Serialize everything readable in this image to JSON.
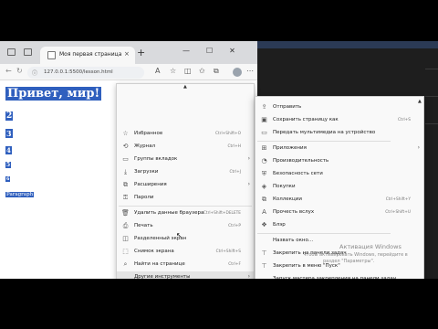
{
  "browser": {
    "tab_title": "Моя первая страница",
    "close_glyph": "×",
    "new_tab_glyph": "+",
    "url": "127.0.0.1:5500/lesson.html",
    "window_buttons": [
      "—",
      "☐",
      "✕"
    ]
  },
  "page": {
    "heading": "Привет, мир!",
    "items": [
      "2",
      "3",
      "4",
      "5",
      "6"
    ],
    "paragraph": "Paragraph"
  },
  "menu": {
    "items": [
      {
        "label": "Избранное",
        "shortcut": "Ctrl+Shift+O",
        "icon": "star-list-icon"
      },
      {
        "label": "Журнал",
        "shortcut": "Ctrl+H",
        "icon": "history-icon"
      },
      {
        "label": "Группы вкладок",
        "shortcut": "",
        "icon": "tab-groups-icon",
        "arrow": true
      },
      {
        "label": "Загрузки",
        "shortcut": "Ctrl+J",
        "icon": "download-icon"
      },
      {
        "label": "Расширения",
        "shortcut": "",
        "icon": "extensions-icon",
        "arrow": true
      },
      {
        "label": "Пароли",
        "shortcut": "",
        "icon": "key-icon"
      },
      {
        "label": "Удалить данные браузера",
        "shortcut": "Ctrl+Shift+DELETE",
        "icon": "trash-icon",
        "sep_before": true
      },
      {
        "label": "Печать",
        "shortcut": "Ctrl+P",
        "icon": "print-icon"
      },
      {
        "label": "Разделенный экран",
        "shortcut": "",
        "icon": "split-screen-icon"
      },
      {
        "label": "Снимок экрана",
        "shortcut": "Ctrl+Shift+S",
        "icon": "screenshot-icon"
      },
      {
        "label": "Найти на странице",
        "shortcut": "Ctrl+F",
        "icon": "find-icon"
      },
      {
        "label": "Другие инструменты",
        "shortcut": "",
        "icon": "",
        "arrow": true,
        "highlight": true
      },
      {
        "label": "Параметры",
        "shortcut": "",
        "icon": "gear-icon",
        "sep_before": true
      },
      {
        "label": "Справка и отзывы",
        "shortcut": "",
        "icon": "help-icon",
        "arrow": true
      },
      {
        "label": "Закрыть Microsoft Edge",
        "shortcut": "",
        "icon": "",
        "sep_before": true
      }
    ]
  },
  "submenu": {
    "items": [
      {
        "label": "Отправить",
        "shortcut": "",
        "icon": "share-icon"
      },
      {
        "label": "Сохранить страницу как",
        "shortcut": "Ctrl+S",
        "icon": "save-icon"
      },
      {
        "label": "Передать мультимедиа на устройство",
        "shortcut": "",
        "icon": "cast-icon"
      },
      {
        "label": "Приложения",
        "shortcut": "",
        "icon": "apps-icon",
        "arrow": true,
        "sep_before": true
      },
      {
        "label": "Производительность",
        "shortcut": "",
        "icon": "performance-icon"
      },
      {
        "label": "Безопасность сети",
        "shortcut": "",
        "icon": "shield-icon"
      },
      {
        "label": "Покупки",
        "shortcut": "",
        "icon": "shopping-icon"
      },
      {
        "label": "Коллекции",
        "shortcut": "Ctrl+Shift+Y",
        "icon": "collections-icon"
      },
      {
        "label": "Прочесть вслух",
        "shortcut": "Ctrl+Shift+U",
        "icon": "read-aloud-icon"
      },
      {
        "label": "Блэр",
        "shortcut": "",
        "icon": "copilot-icon"
      },
      {
        "label": "Назвать окно...",
        "shortcut": "",
        "icon": "",
        "sep_before": true
      },
      {
        "label": "Закрепить на панели задач",
        "shortcut": "",
        "icon": "pin-taskbar-icon"
      },
      {
        "label": "Закрепить в меню \"Пуск\"",
        "shortcut": "",
        "icon": "pin-start-icon"
      },
      {
        "label": "Запуск мастера закрепления на панели задач",
        "shortcut": "",
        "icon": ""
      },
      {
        "label": "Запуск панели поиска",
        "shortcut": "",
        "icon": ""
      },
      {
        "label": "Диспетчер задач браузера",
        "shortcut": "Shift+Esc",
        "icon": ""
      },
      {
        "label": "Средства разработчика",
        "shortcut": "Ctrl+Shift+I",
        "icon": "devtools-icon",
        "sep_before": true
      }
    ]
  },
  "watermark": {
    "title": "Активация Windows",
    "line1": "Чтобы активировать Windows, перейдите в",
    "line2": "раздел \"Параметры\"."
  },
  "icons": {
    "star-list-icon": "☆",
    "history-icon": "⟲",
    "tab-groups-icon": "▭",
    "download-icon": "⤓",
    "extensions-icon": "⧉",
    "key-icon": "⚿",
    "trash-icon": "🗑",
    "print-icon": "⎙",
    "split-screen-icon": "◫",
    "screenshot-icon": "⬚",
    "find-icon": "⌕",
    "gear-icon": "⚙",
    "help-icon": "?",
    "share-icon": "⇪",
    "save-icon": "▣",
    "cast-icon": "▭",
    "apps-icon": "⊞",
    "performance-icon": "◔",
    "shield-icon": "⛨",
    "shopping-icon": "◈",
    "collections-icon": "⧉",
    "read-aloud-icon": "A",
    "copilot-icon": "❖",
    "pin-taskbar-icon": "⊤",
    "pin-start-icon": "⊤",
    "devtools-icon": "⚒"
  }
}
